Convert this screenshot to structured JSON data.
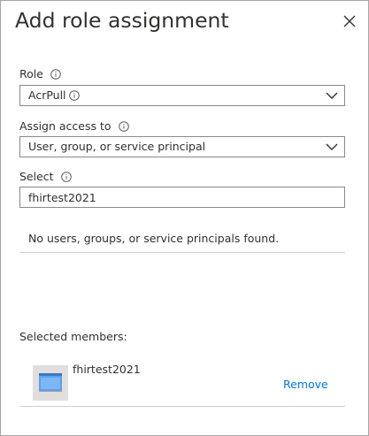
{
  "panel": {
    "title": "Add role assignment"
  },
  "role": {
    "label": "Role",
    "value": "AcrPull"
  },
  "assign_access": {
    "label": "Assign access to",
    "value": "User, group, or service principal"
  },
  "select": {
    "label": "Select",
    "value": "fhirtest2021",
    "empty_message": "No users, groups, or service principals found."
  },
  "selected_members": {
    "label": "Selected members:",
    "items": [
      {
        "name": "fhirtest2021",
        "remove_label": "Remove"
      }
    ]
  },
  "colors": {
    "link": "#0078d4",
    "border": "#8a8886",
    "text": "#323130"
  }
}
